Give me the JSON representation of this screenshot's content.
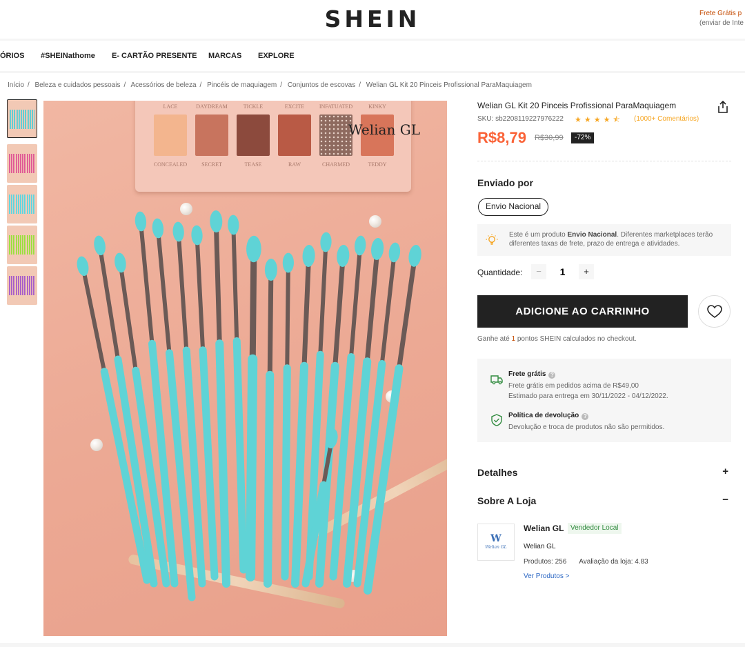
{
  "header": {
    "logo": "SHEIN",
    "promo_title": "Frete Grátis",
    "promo_title_suffix": "p",
    "promo_sub": "(enviar de Inte"
  },
  "nav": {
    "items": [
      "ÓRIOS",
      "#SHEINathome",
      "E- CARTÃO PRESENTE",
      "MARCAS",
      "EXPLORE"
    ]
  },
  "breadcrumb": {
    "items": [
      "Início",
      "Beleza e cuidados pessoais",
      "Acessórios de beleza",
      "Pincéis de maquiagem",
      "Conjuntos de escovas",
      "Welian GL Kit 20 Pinceis Profissional ParaMaquiagem"
    ]
  },
  "gallery": {
    "watermark": "Welian GL",
    "palette_top": [
      "LACE",
      "DAYDREAM",
      "TICKLE",
      "EXCITE",
      "INFATUATED",
      "KINKY"
    ],
    "palette_bottom": [
      "CONCEALED",
      "SECRET",
      "TEASE",
      "RAW",
      "CHARMED",
      "TEDDY"
    ],
    "palette_colors": [
      "#f3b58e",
      "#c8745e",
      "#8c4a3d",
      "#b95a45",
      "#8e6a5f",
      "#d8755a"
    ],
    "thumbnail_colors": [
      "#4fd0d6",
      "#e05a96",
      "#5fd6e0",
      "#9be03f",
      "#a85ec9"
    ],
    "brush_color": "#5fd3d6"
  },
  "product": {
    "title": "Welian GL Kit 20 Pinceis Profissional ParaMaquiagem",
    "sku": "SKU: sb2208119227976222",
    "rating": 4.5,
    "reviews": "(1000+ Comentários)",
    "price": "R$8,79",
    "old_price": "R$30,99",
    "discount": "-72%"
  },
  "shipping": {
    "heading": "Enviado por",
    "option": "Envio Nacional",
    "notice_pre": "Este é um produto ",
    "notice_bold": "Envio Nacional",
    "notice_post": ". Diferentes marketplaces terão diferentes taxas de frete, prazo de entrega e atividades."
  },
  "quantity": {
    "label": "Quantidade:",
    "value": "1",
    "minus": "−",
    "plus": "+"
  },
  "cart": {
    "add_label": "ADICIONE AO CARRINHO",
    "points_pre": "Ganhe até ",
    "points_num": "1",
    "points_post": " pontos SHEIN calculados no checkout."
  },
  "benefits": {
    "free_title": "Frete grátis",
    "free_line1": "Frete grátis em pedidos acima de R$49,00",
    "free_line2": "Estimado para entrega em 30/11/2022 - 04/12/2022.",
    "return_title": "Política de devolução",
    "return_line": "Devolução e troca de produtos não são permitidos."
  },
  "accordion": {
    "details": "Detalhes",
    "details_sign": "+",
    "store": "Sobre A Loja",
    "store_sign": "−"
  },
  "store": {
    "name": "Welian GL",
    "badge": "Vendedor Local",
    "subname": "Welian GL",
    "products": "Produtos: 256",
    "rating": "Avaliação da loja: 4.83",
    "link": "Ver Produtos >",
    "logo_mark": "W",
    "logo_text": "Welian GL"
  },
  "colors": {
    "accent_price": "#fa6338",
    "star": "#f6a623",
    "link": "#2d68c4"
  }
}
